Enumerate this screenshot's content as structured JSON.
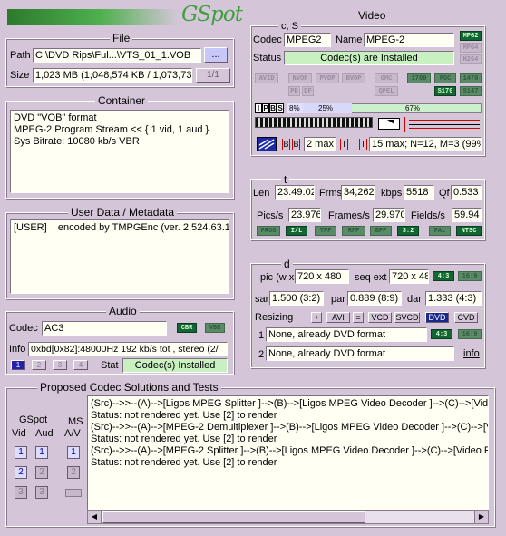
{
  "app": {
    "logo": "GSpot"
  },
  "file": {
    "title": "File",
    "path_label": "Path",
    "path_value": "C:\\DVD Rips\\Ful...\\VTS_01_1.VOB",
    "browse_label": "...",
    "size_label": "Size",
    "size_value": "1,023 MB (1,048,574 KB / 1,073,73",
    "page_label": "1/1"
  },
  "container": {
    "title": "Container",
    "text": "DVD \"VOB\" format\nMPEG-2 Program Stream << { 1 vid, 1 aud }\nSys Bitrate: 10080 kb/s VBR"
  },
  "userdata": {
    "title": "User Data / Metadata",
    "text": "[USER]    encoded by TMPGEnc (ver. 2.524.63.1"
  },
  "audio": {
    "title": "Audio",
    "codec_label": "Codec",
    "codec_value": "AC3",
    "cbr": "CBR",
    "vbr": "VBR",
    "info_label": "Info",
    "info_value": "0xbd[0x82]:48000Hz  192 kb/s tot , stereo (2/",
    "streams": [
      "1",
      "2",
      "3",
      "4"
    ],
    "stat_label": "Stat",
    "stat_value": "Codec(s) Installed"
  },
  "video": {
    "title": "Video",
    "cs_label": "c, S",
    "codec_label": "Codec",
    "codec_value": "MPEG2",
    "name_label": "Name",
    "name_value": "MPEG-2",
    "status_label": "Status",
    "status_value": "Codec(s) are Installed",
    "fmt_leds": [
      "MPG2",
      "MPG4",
      "H264"
    ],
    "row1": [
      "AVID",
      "NVOP",
      "PVOP",
      "BVOP",
      "GMC",
      "1700",
      "FOC",
      "1470"
    ],
    "row2": [
      "PB",
      "DF",
      "QPEL",
      "S170",
      "S147"
    ],
    "frame_types": [
      "I",
      "P",
      "B",
      "S"
    ],
    "pct": [
      "8%",
      "25%",
      "67%"
    ],
    "ctrl": [
      "B",
      "B",
      "2 max",
      "I",
      "I",
      "15 max; N=12, M=3 (99%"
    ]
  },
  "timing": {
    "title": "t",
    "len_label": "Len",
    "len_value": "23:49.02",
    "frms_label": "Frms",
    "frms_value": "34,262",
    "kbps_label": "kbps",
    "kbps_value": "5518",
    "qf_label": "Qf",
    "qf_value": "0.533",
    "pics_label": "Pics/s",
    "pics_value": "23.976",
    "frames_label": "Frames/s",
    "frames_value": "29.970",
    "fields_label": "Fields/s",
    "fields_value": "59.94",
    "leds": [
      "PROG",
      "I/L",
      "TFF",
      "RFF",
      "BFF",
      "3:2",
      "PAL",
      "NTSC"
    ]
  },
  "dims": {
    "title": "d",
    "pic_label": "pic (w x",
    "pic_value": "720 x 480",
    "seq_label": "seq ext",
    "seq_value": "720 x 48",
    "ar1": "4:3",
    "ar2": "16:9",
    "sar_label": "sar",
    "sar_value": "1.500 (3:2)",
    "par_label": "par",
    "par_value": "0.889 (8:9)",
    "dar_label": "dar",
    "dar_value": "1.333 (4:3)",
    "resizing_label": "Resizing",
    "resize_btns": [
      "+",
      "AVI",
      "=",
      "VCD",
      "SVCD",
      "DVD",
      "CVD"
    ],
    "r1_num": "1",
    "r1_value": "None, already DVD format",
    "r1_a": "4:3",
    "r1_b": "16:9",
    "r2_num": "2",
    "r2_value": "None, already DVD format",
    "info_link": "info"
  },
  "proposed": {
    "title": "Proposed Codec Solutions and Tests",
    "gspot_label": "GSpot",
    "vid_label": "Vid",
    "aud_label": "Aud",
    "ms_label": "MS",
    "av_label": "A/V",
    "text": "(Src)-->>--(A)-->[Ligos MPEG Splitter ]-->(B)-->[Ligos MPEG Video Decoder ]-->(C)-->[Video Re\nStatus: not rendered yet. Use [2] to render\n(Src)-->>--(A)-->[MPEG-2 Demultiplexer ]-->(B)-->[Ligos MPEG Video Decoder ]-->(C)-->[Video R\nStatus: not rendered yet. Use [2] to render\n(Src)-->>--(A)-->[MPEG-2 Splitter ]-->(B)-->[Ligos MPEG Video Decoder ]-->(C)-->[Video Render\nStatus: not rendered yet. Use [2] to render"
  },
  "colors": {
    "background": "#d4c6d8",
    "led_on": "#116633",
    "field": "#fffff4",
    "green_field": "#c8f0c0",
    "logo": "#3fa03f"
  }
}
